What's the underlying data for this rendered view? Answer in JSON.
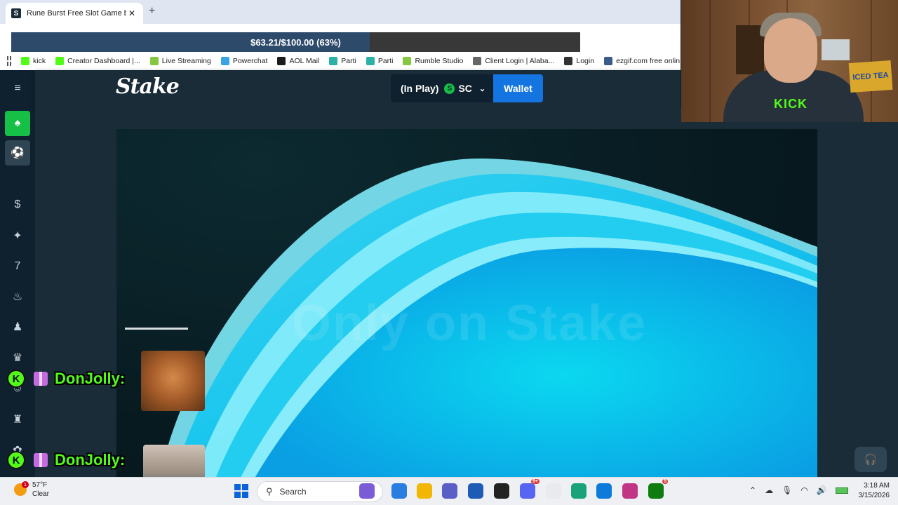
{
  "browser": {
    "tab_title": "Rune Burst Free Slot Game by A",
    "tab_favicon": "S",
    "tab_close": "✕",
    "new_tab": "+",
    "bookmarks": [
      {
        "label": "kick",
        "icon": "kick-icon",
        "color": "#53fc18"
      },
      {
        "label": "Creator Dashboard |...",
        "icon": "kick-icon",
        "color": "#53fc18"
      },
      {
        "label": "Live Streaming",
        "icon": "play-icon",
        "color": "#85c742"
      },
      {
        "label": "Powerchat",
        "icon": "powerchat-icon",
        "color": "#3aa3e3"
      },
      {
        "label": "AOL Mail",
        "icon": "aol-icon",
        "color": "#1c1c1c"
      },
      {
        "label": "Parti",
        "icon": "parti-icon",
        "color": "#2db1a6"
      },
      {
        "label": "Parti",
        "icon": "parti-icon",
        "color": "#2db1a6"
      },
      {
        "label": "Rumble Studio",
        "icon": "rumble-icon",
        "color": "#85c742"
      },
      {
        "label": "Client Login | Alaba...",
        "icon": "document-icon",
        "color": "#666666"
      },
      {
        "label": "Login",
        "icon": "login-icon",
        "color": "#333333"
      },
      {
        "label": "ezgif.com free onlin...",
        "icon": "ezgif-icon",
        "color": "#3b5b8a"
      }
    ]
  },
  "goal": {
    "text": "$63.21/$100.00 (63%)",
    "fraction": 0.63
  },
  "stake": {
    "logo": "Stake",
    "balance_label": "(In Play)",
    "currency_symbol": "S",
    "currency": "SC",
    "chevron": "⌄",
    "wallet_label": "Wallet",
    "watermark": "Only on Stake",
    "sidebar_icons": [
      "menu-icon",
      "casino-icon",
      "sports-icon",
      "stake-originals-icon",
      "new-releases-icon",
      "slots-icon",
      "hot-icon",
      "live-casino-icon",
      "crown-icon",
      "game-shows-icon",
      "table-games-icon",
      "bonus-icon"
    ],
    "accent": "#1475e1",
    "active_green": "#16c047"
  },
  "chat": [
    {
      "username": "DonJolly:",
      "badge": "K"
    },
    {
      "username": "DonJolly:",
      "badge": "K"
    }
  ],
  "webcam": {
    "shirt_text": "KICK",
    "sign_text": "ICED TEA"
  },
  "taskbar": {
    "weather_temp": "57°F",
    "weather_desc": "Clear",
    "weather_badge": "1",
    "search_label": "Search",
    "time": "3:18 AM",
    "date": "3/15/2026",
    "apps": [
      "clapper-icon",
      "copilot-icon",
      "file-explorer-icon",
      "teams-icon",
      "store-icon",
      "obs-icon",
      "discord-icon",
      "chrome-icon",
      "photos-icon",
      "edge-icon",
      "instagram-icon",
      "xbox-icon"
    ],
    "discord_badge": "9+",
    "xbox_badge": "5"
  }
}
